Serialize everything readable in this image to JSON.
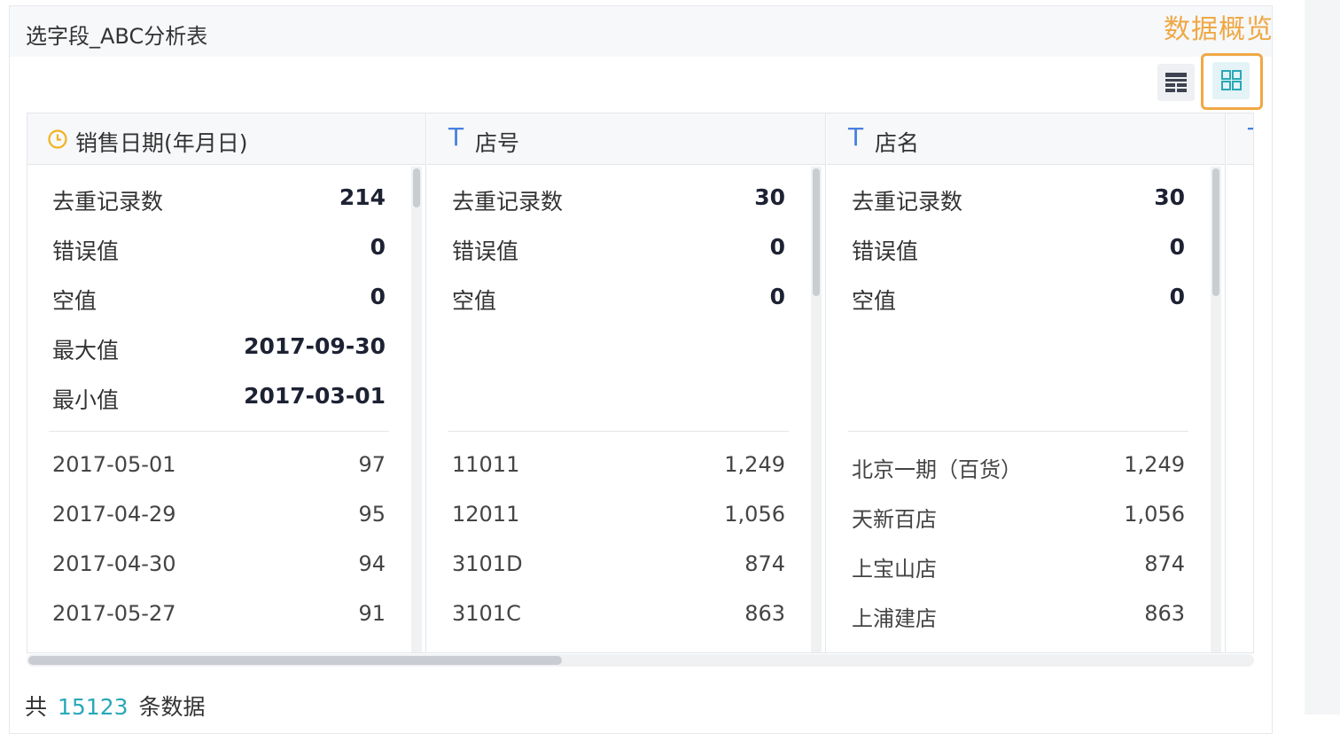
{
  "panel": {
    "title": "选字段_ABC分析表"
  },
  "annotation": "数据概览",
  "view_buttons": {
    "table_icon": "table-view-icon",
    "grid_icon": "grid-view-icon"
  },
  "columns": [
    {
      "type_icon": "clock-icon",
      "title": "销售日期(年月日)",
      "stats": [
        {
          "label": "去重记录数",
          "value": "214"
        },
        {
          "label": "错误值",
          "value": "0"
        },
        {
          "label": "空值",
          "value": "0"
        },
        {
          "label": "最大值",
          "value": "2017-09-30"
        },
        {
          "label": "最小值",
          "value": "2017-03-01"
        }
      ],
      "values": [
        {
          "label": "2017-05-01",
          "count": "97"
        },
        {
          "label": "2017-04-29",
          "count": "95"
        },
        {
          "label": "2017-04-30",
          "count": "94"
        },
        {
          "label": "2017-05-27",
          "count": "91"
        }
      ]
    },
    {
      "type_icon": "T",
      "title": "店号",
      "stats": [
        {
          "label": "去重记录数",
          "value": "30"
        },
        {
          "label": "错误值",
          "value": "0"
        },
        {
          "label": "空值",
          "value": "0"
        }
      ],
      "values": [
        {
          "label": "11011",
          "count": "1,249"
        },
        {
          "label": "12011",
          "count": "1,056"
        },
        {
          "label": "3101D",
          "count": "874"
        },
        {
          "label": "3101C",
          "count": "863"
        }
      ]
    },
    {
      "type_icon": "T",
      "title": "店名",
      "stats": [
        {
          "label": "去重记录数",
          "value": "30"
        },
        {
          "label": "错误值",
          "value": "0"
        },
        {
          "label": "空值",
          "value": "0"
        }
      ],
      "values": [
        {
          "label": "北京一期（百货）",
          "count": "1,249"
        },
        {
          "label": "天新百店",
          "count": "1,056"
        },
        {
          "label": "上宝山店",
          "count": "874"
        },
        {
          "label": "上浦建店",
          "count": "863"
        }
      ]
    },
    {
      "type_icon": "T",
      "title": ""
    }
  ],
  "footer": {
    "prefix": "共",
    "count": "15123",
    "suffix": "条数据"
  },
  "colors": {
    "accent": "#2aa8b8",
    "annotation": "#f0a845",
    "type_t": "#4a7fe0",
    "clock": "#f2b21c"
  }
}
